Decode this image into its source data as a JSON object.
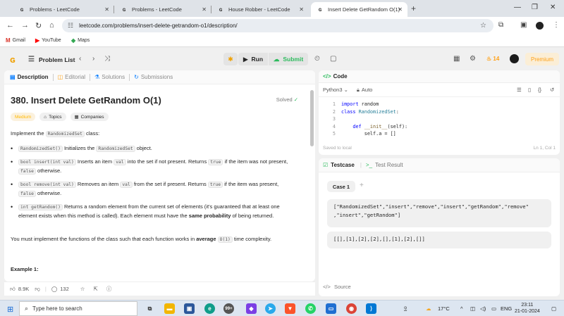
{
  "browser": {
    "tabs": [
      {
        "title": "Problems - LeetCode",
        "active": false
      },
      {
        "title": "Problems - LeetCode",
        "active": false
      },
      {
        "title": "House Robber - LeetCode",
        "active": false
      },
      {
        "title": "Insert Delete GetRandom O(1)",
        "active": true
      }
    ],
    "new_tab": "+",
    "url": "leetcode.com/problems/insert-delete-getrandom-o1/description/",
    "bookmarks": [
      {
        "label": "Gmail",
        "icon": "gmail-icon"
      },
      {
        "label": "YouTube",
        "icon": "youtube-icon"
      },
      {
        "label": "Maps",
        "icon": "maps-icon"
      }
    ]
  },
  "header": {
    "problem_list": "Problem List",
    "run": "Run",
    "submit": "Submit",
    "streak": "14",
    "premium": "Premium"
  },
  "left_tabs": [
    {
      "label": "Description",
      "icon": "description-icon",
      "active": true
    },
    {
      "label": "Editorial",
      "icon": "editorial-icon",
      "active": false
    },
    {
      "label": "Solutions",
      "icon": "solutions-icon",
      "active": false
    },
    {
      "label": "Submissions",
      "icon": "submissions-icon",
      "active": false
    }
  ],
  "problem": {
    "title": "380. Insert Delete GetRandom O(1)",
    "status": "Solved",
    "difficulty": "Medium",
    "topics": "Topics",
    "companies": "Companies",
    "intro_pre": "Implement the ",
    "intro_code": "RandomizedSet",
    "intro_post": " class:",
    "bullets": [
      {
        "code": "RandomizedSet()",
        "text": " Initializes the ",
        "code2": "RandomizedSet",
        "text2": " object."
      },
      {
        "code": "bool insert(int val)",
        "text": " Inserts an item ",
        "code2": "val",
        "text2": " into the set if not present. Returns ",
        "code3": "true",
        "text3": " if the item was not present, ",
        "code4": "false",
        "text4": " otherwise."
      },
      {
        "code": "bool remove(int val)",
        "text": " Removes an item ",
        "code2": "val",
        "text2": " from the set if present. Returns ",
        "code3": "true",
        "text3": " if the item was present, ",
        "code4": "false",
        "text4": " otherwise."
      },
      {
        "code": "int getRandom()",
        "text": " Returns a random element from the current set of elements (it's guaranteed that at least one element exists when this method is called). Each element must have the ",
        "bold": "same probability",
        "text2": " of being returned."
      }
    ],
    "complexity_pre": "You must implement the functions of the class such that each function works in ",
    "complexity_bold": "average",
    "complexity_code": "O(1)",
    "complexity_post": " time complexity.",
    "example_heading": "Example 1:"
  },
  "stats": {
    "likes": "8.9K",
    "comments": "132"
  },
  "code_panel": {
    "title": "Code",
    "language": "Python3",
    "mode": "Auto",
    "lines": [
      {
        "n": "1",
        "tokens": [
          {
            "t": "import",
            "c": "kw"
          },
          {
            "t": " random",
            "c": ""
          }
        ]
      },
      {
        "n": "2",
        "tokens": [
          {
            "t": "class",
            "c": "kw"
          },
          {
            "t": " ",
            "c": ""
          },
          {
            "t": "RandomizedSet",
            "c": "cls"
          },
          {
            "t": ":",
            "c": ""
          }
        ]
      },
      {
        "n": "3",
        "tokens": []
      },
      {
        "n": "4",
        "tokens": [
          {
            "t": "    ",
            "c": ""
          },
          {
            "t": "def",
            "c": "kw"
          },
          {
            "t": " ",
            "c": ""
          },
          {
            "t": "__init__",
            "c": "fn"
          },
          {
            "t": "(self):",
            "c": ""
          }
        ]
      },
      {
        "n": "5",
        "tokens": [
          {
            "t": "        self.a = []",
            "c": ""
          }
        ]
      }
    ],
    "saved": "Saved to local",
    "cursor": "Ln 1, Col 1"
  },
  "test_panel": {
    "testcase_tab": "Testcase",
    "result_tab": "Test Result",
    "case_label": "Case 1",
    "add_case": "+",
    "input1_line1": "[\"RandomizedSet\",\"insert\",\"remove\",\"insert\",\"getRandom\",\"remove\"",
    "input1_line2": ",\"insert\",\"getRandom\"]",
    "input2": "[[],[1],[2],[2],[],[1],[2],[]]",
    "source": "Source"
  },
  "taskbar": {
    "search_placeholder": "Type here to search",
    "badge": "99+",
    "temperature": "17°C",
    "language": "ENG",
    "time": "23:11",
    "date": "21-01-2024"
  }
}
